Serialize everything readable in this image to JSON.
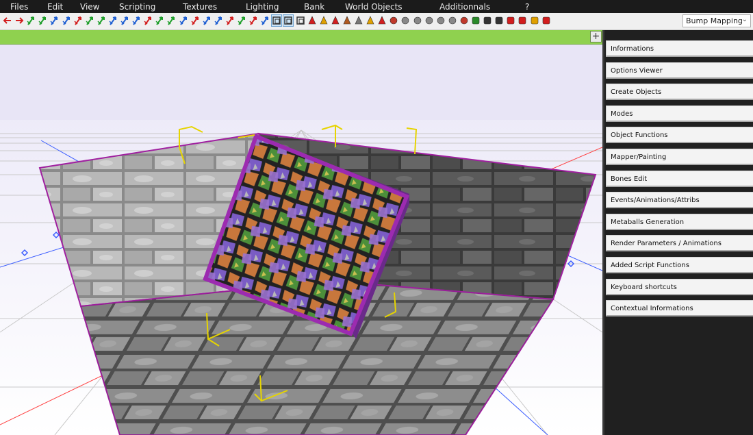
{
  "menu": {
    "items": [
      "Files",
      "Edit",
      "View",
      "Scripting",
      "Textures",
      "Lighting",
      "Bank",
      "World Objects",
      "Additionnals",
      "?"
    ]
  },
  "toolbar": {
    "tools": [
      {
        "icon": "arrow-left-red-icon",
        "color": "#d21e1e"
      },
      {
        "icon": "arrow-right-red-icon",
        "color": "#d21e1e"
      },
      {
        "icon": "move-up-green-icon",
        "color": "#1e9e2a"
      },
      {
        "icon": "move-down-green-icon",
        "color": "#1e9e2a"
      },
      {
        "icon": "axis-z-blue-icon",
        "color": "#1e5fd2"
      },
      {
        "icon": "axis-x-blue-icon",
        "color": "#1e5fd2"
      },
      {
        "icon": "rotate-x-red-icon",
        "color": "#d21e1e"
      },
      {
        "icon": "rotate-y-green-icon",
        "color": "#1e9e2a"
      },
      {
        "icon": "rotate-z-green-icon",
        "color": "#1e9e2a"
      },
      {
        "icon": "axis-xyz-blue-icon",
        "color": "#1e5fd2"
      },
      {
        "icon": "axis-zy-blue-icon",
        "color": "#1e5fd2"
      },
      {
        "icon": "scale-x-blue-icon",
        "color": "#1e5fd2"
      },
      {
        "icon": "scale-xy-red-icon",
        "color": "#d21e1e"
      },
      {
        "icon": "scale-y-green-icon",
        "color": "#1e9e2a"
      },
      {
        "icon": "scale-yz-green-icon",
        "color": "#1e9e2a"
      },
      {
        "icon": "scale-z-blue-icon",
        "color": "#1e5fd2"
      },
      {
        "icon": "paint-red-icon",
        "color": "#d21e1e"
      },
      {
        "icon": "paint-blue-icon",
        "color": "#1e5fd2"
      },
      {
        "icon": "brush-blue-icon",
        "color": "#1e5fd2"
      },
      {
        "icon": "brush-red-icon",
        "color": "#d21e1e"
      },
      {
        "icon": "brush-green-icon",
        "color": "#1e9e2a"
      },
      {
        "icon": "brush-red2-icon",
        "color": "#d21e1e"
      },
      {
        "icon": "brush-blue2-icon",
        "color": "#1e5fd2"
      },
      {
        "icon": "select-box-icon",
        "color": "#333333"
      },
      {
        "icon": "select-multi-icon",
        "color": "#333333"
      },
      {
        "icon": "cube-icon",
        "color": "#333333"
      },
      {
        "icon": "light-red-icon",
        "color": "#d21e1e"
      },
      {
        "icon": "light-yellow-icon",
        "color": "#e0a000"
      },
      {
        "icon": "cone-icon",
        "color": "#d21e1e"
      },
      {
        "icon": "bone-icon",
        "color": "#b05a20"
      },
      {
        "icon": "wand-icon",
        "color": "#777777"
      },
      {
        "icon": "bulb-icon",
        "color": "#e0a000"
      },
      {
        "icon": "play-icon",
        "color": "#d21e1e"
      },
      {
        "icon": "camera-icon",
        "color": "#c0392b"
      },
      {
        "icon": "mesh-grey-icon",
        "color": "#888888"
      },
      {
        "icon": "mesh-grey2-icon",
        "color": "#888888"
      },
      {
        "icon": "mesh-grey3-icon",
        "color": "#888888"
      },
      {
        "icon": "mesh-grey4-icon",
        "color": "#888888"
      },
      {
        "icon": "sphere-icon",
        "color": "#888888"
      },
      {
        "icon": "save-icon",
        "color": "#c0392b"
      },
      {
        "icon": "bottle-icon",
        "color": "#2a8a2a"
      },
      {
        "icon": "disk-icon",
        "color": "#333333"
      },
      {
        "icon": "monitor-icon",
        "color": "#333333"
      },
      {
        "icon": "stop-icon",
        "color": "#d21e1e"
      },
      {
        "icon": "record-icon",
        "color": "#d21e1e"
      },
      {
        "icon": "warning-icon",
        "color": "#e0a000"
      },
      {
        "icon": "grid-icon",
        "color": "#d21e1e"
      }
    ],
    "mode_select": "Bump Mapping"
  },
  "viewport": {
    "header_color": "#8fd14f",
    "add_label": "+"
  },
  "panel": {
    "buttons": [
      "Informations",
      "Options Viewer",
      "Create Objects",
      "Modes",
      "Object Functions",
      "Mapper/Painting",
      "Bones Edit",
      "Events/Animations/Attribs",
      "Metaballs Generation",
      "Render Parameters / Animations",
      "Added Script Functions",
      "Keyboard shortcuts",
      "Contextual Informations"
    ]
  }
}
